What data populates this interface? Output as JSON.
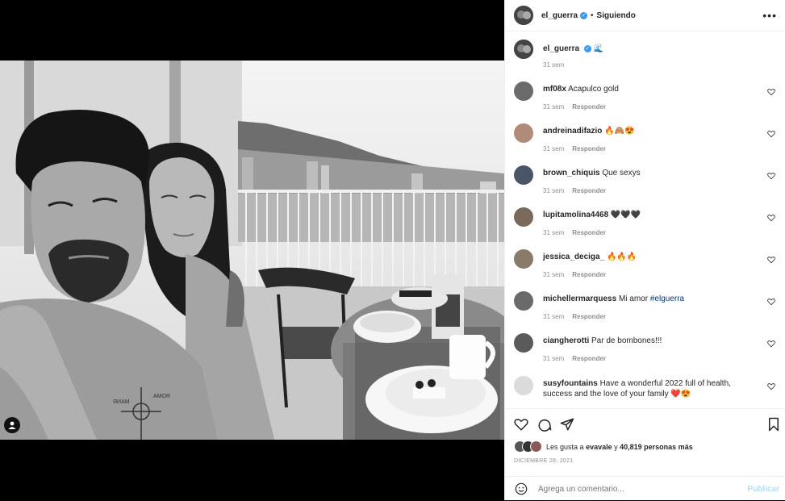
{
  "post": {
    "username": "el_guerra",
    "following_label": "Siguiendo",
    "separator": "•",
    "more_label": "•••",
    "caption_emoji": "🌊",
    "caption_time": "31 sem"
  },
  "comments": [
    {
      "user": "mf08x",
      "text": "Acapulco gold",
      "time": "31 sem",
      "reply": "Responder",
      "avatar_color": "#6b6b6b"
    },
    {
      "user": "andreinadifazio",
      "text": "🔥🙈😍",
      "time": "31 sem",
      "reply": "Responder",
      "avatar_color": "#b08b7a"
    },
    {
      "user": "brown_chiquis",
      "text": "Que sexys",
      "time": "31 sem",
      "reply": "Responder",
      "avatar_color": "#4a5568"
    },
    {
      "user": "lupitamolina4468",
      "text": "🖤🖤🖤",
      "time": "31 sem",
      "reply": "Responder",
      "avatar_color": "#7a6a5a"
    },
    {
      "user": "jessica_deciga_",
      "text": "🔥🔥🔥",
      "time": "31 sem",
      "reply": "Responder",
      "avatar_color": "#8a7a6a"
    },
    {
      "user": "michellermarquess",
      "text": "Mi amor",
      "hashtag": "#elguerra",
      "time": "31 sem",
      "reply": "Responder",
      "avatar_color": "#6a6a6a"
    },
    {
      "user": "ciangherotti",
      "text": "Par de bombones!!!",
      "time": "31 sem",
      "reply": "Responder",
      "avatar_color": "#5a5a5a"
    },
    {
      "user": "susyfountains",
      "text": "Have a wonderful 2022 full of health, success and the love of your family ❤️😍",
      "avatar_color": "#dbdbdb"
    }
  ],
  "likes": {
    "prefix": "Les gusta a",
    "user": "evavale",
    "conj": "y",
    "count": "40,819 personas más"
  },
  "date": "DICIEMBRE 28, 2021",
  "add_comment": {
    "placeholder": "Agrega un comentario...",
    "publish": "Publicar"
  },
  "colors": {
    "verified": "#3897f0",
    "border": "#efefef",
    "secondary_text": "#8e8e8e",
    "publish_disabled": "#b2dffc"
  }
}
